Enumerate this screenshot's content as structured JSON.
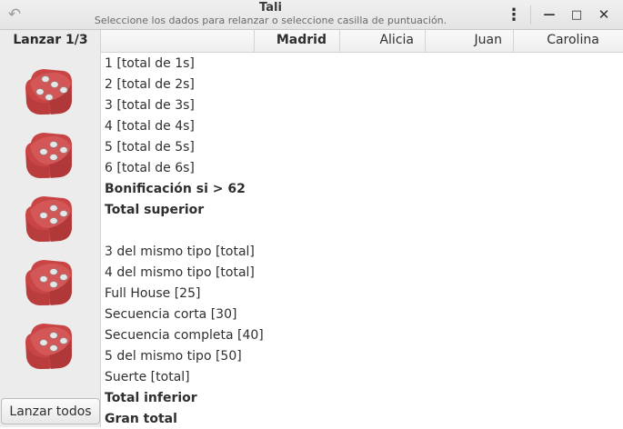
{
  "app": {
    "title": "Tali",
    "subtitle": "Seleccione los dados para relanzar o seleccione casilla de puntuación."
  },
  "header": {
    "undo_icon": "↶",
    "menu_icon": "⋮",
    "minimize_icon": "—",
    "maximize_icon": "□",
    "close_icon": "✕"
  },
  "dice_panel": {
    "roll_label": "Lanzar 1/3",
    "dice": [
      {
        "face": 5
      },
      {
        "face": 4
      },
      {
        "face": 4
      },
      {
        "face": 4
      },
      {
        "face": 4
      }
    ],
    "die_color": "#c94545",
    "roll_all_label": "Lanzar todos"
  },
  "players": [
    "Madrid",
    "Alicia",
    "Juan",
    "Carolina"
  ],
  "rows": [
    {
      "label": "1 [total de 1s]",
      "bold": false
    },
    {
      "label": "2 [total de 2s]",
      "bold": false
    },
    {
      "label": "3 [total de 3s]",
      "bold": false
    },
    {
      "label": "4 [total de 4s]",
      "bold": false
    },
    {
      "label": "5 [total de 5s]",
      "bold": false
    },
    {
      "label": "6 [total de 6s]",
      "bold": false
    },
    {
      "label": "Bonificación si > 62",
      "bold": true
    },
    {
      "label": "Total superior",
      "bold": true
    },
    {
      "label": "",
      "bold": false
    },
    {
      "label": "3 del mismo tipo [total]",
      "bold": false
    },
    {
      "label": "4 del mismo tipo [total]",
      "bold": false
    },
    {
      "label": "Full House [25]",
      "bold": false
    },
    {
      "label": "Secuencia corta [30]",
      "bold": false
    },
    {
      "label": "Secuencia completa [40]",
      "bold": false
    },
    {
      "label": "5 del mismo tipo [50]",
      "bold": false
    },
    {
      "label": "Suerte [total]",
      "bold": false
    },
    {
      "label": "Total inferior",
      "bold": true
    },
    {
      "label": "Gran total",
      "bold": true
    }
  ]
}
